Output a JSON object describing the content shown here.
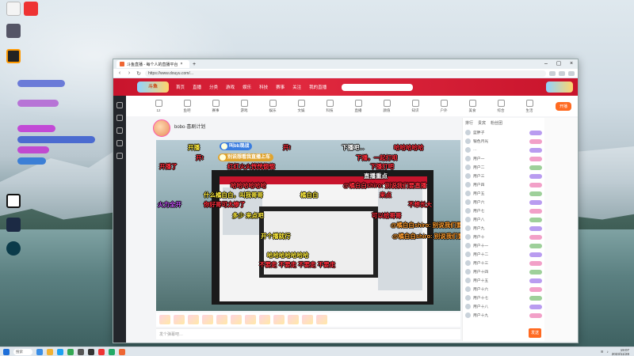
{
  "browser": {
    "tab_title": "斗鱼直播 - 每个人的直播平台",
    "url": "https://www.douyu.com/..."
  },
  "site": {
    "nav": [
      "首页",
      "直播",
      "分类",
      "游戏",
      "娱乐",
      "科技",
      "赛事",
      "关注",
      "我的直播"
    ],
    "categories": [
      "12",
      "鱼吧",
      "赛事",
      "游戏",
      "娱乐",
      "文娱",
      "科技",
      "直播",
      "颜值",
      "知识",
      "户外",
      "美食",
      "综合",
      "生活"
    ],
    "open_label": "开播",
    "streamer_name": "bobo·喜剧计划",
    "chat_placeholder": "发个弹幕吧…",
    "send_label": "发送"
  },
  "danmaku": {
    "d1": "开播",
    "d2": "开!",
    "d3": "下播吧...",
    "d4": "哈哈哈哈哈",
    "d5": "开!",
    "d6": "下播，一起打呗",
    "d7": "直播重点",
    "d8": "红红火火恍恍惚惚",
    "d9": "下播打吧",
    "d10": "哈哈哈哈哈哈",
    "d11": "什么橘白白，叫我哥哥",
    "d12": "橘白白",
    "d13": "来点",
    "d14": "火力全开",
    "d15": "你好哥可太惨了",
    "d16": "不想长大",
    "d17": "多少 来点吧",
    "d18": "可以给哥哥",
    "d19": "不想长大",
    "d20": "哈哈哈哈哈哈哈",
    "d21": "@橘白白shiro: 别说我们要直播",
    "d22": "开个播就行",
    "d23": "不要走  不要走  不要走  不要走",
    "d24": "开播了"
  },
  "bubbles": {
    "b1": "叫bb观战",
    "b2": "别说想看我直播上车"
  },
  "rank_panel": {
    "tabs": [
      "排行",
      "贵宾",
      "粉丝团"
    ],
    "rows": [
      "蓝胖子",
      "银色月光",
      "…",
      "用户一",
      "用户二",
      "用户三",
      "用户四",
      "用户五",
      "用户六",
      "用户七",
      "用户八",
      "用户九",
      "用户十",
      "用户十一",
      "用户十二",
      "用户十三",
      "用户十四",
      "用户十五",
      "用户十六",
      "用户十七",
      "用户十八",
      "用户十九"
    ]
  },
  "taskbar": {
    "search_label": "搜索",
    "time": "19:07",
    "date": "2023/11/28"
  },
  "colors": {
    "brand_red": "#c8142c",
    "accent_orange": "#ff6a21",
    "danmu_yellow": "#ffec3d",
    "danmu_red": "#ff2e3c"
  }
}
